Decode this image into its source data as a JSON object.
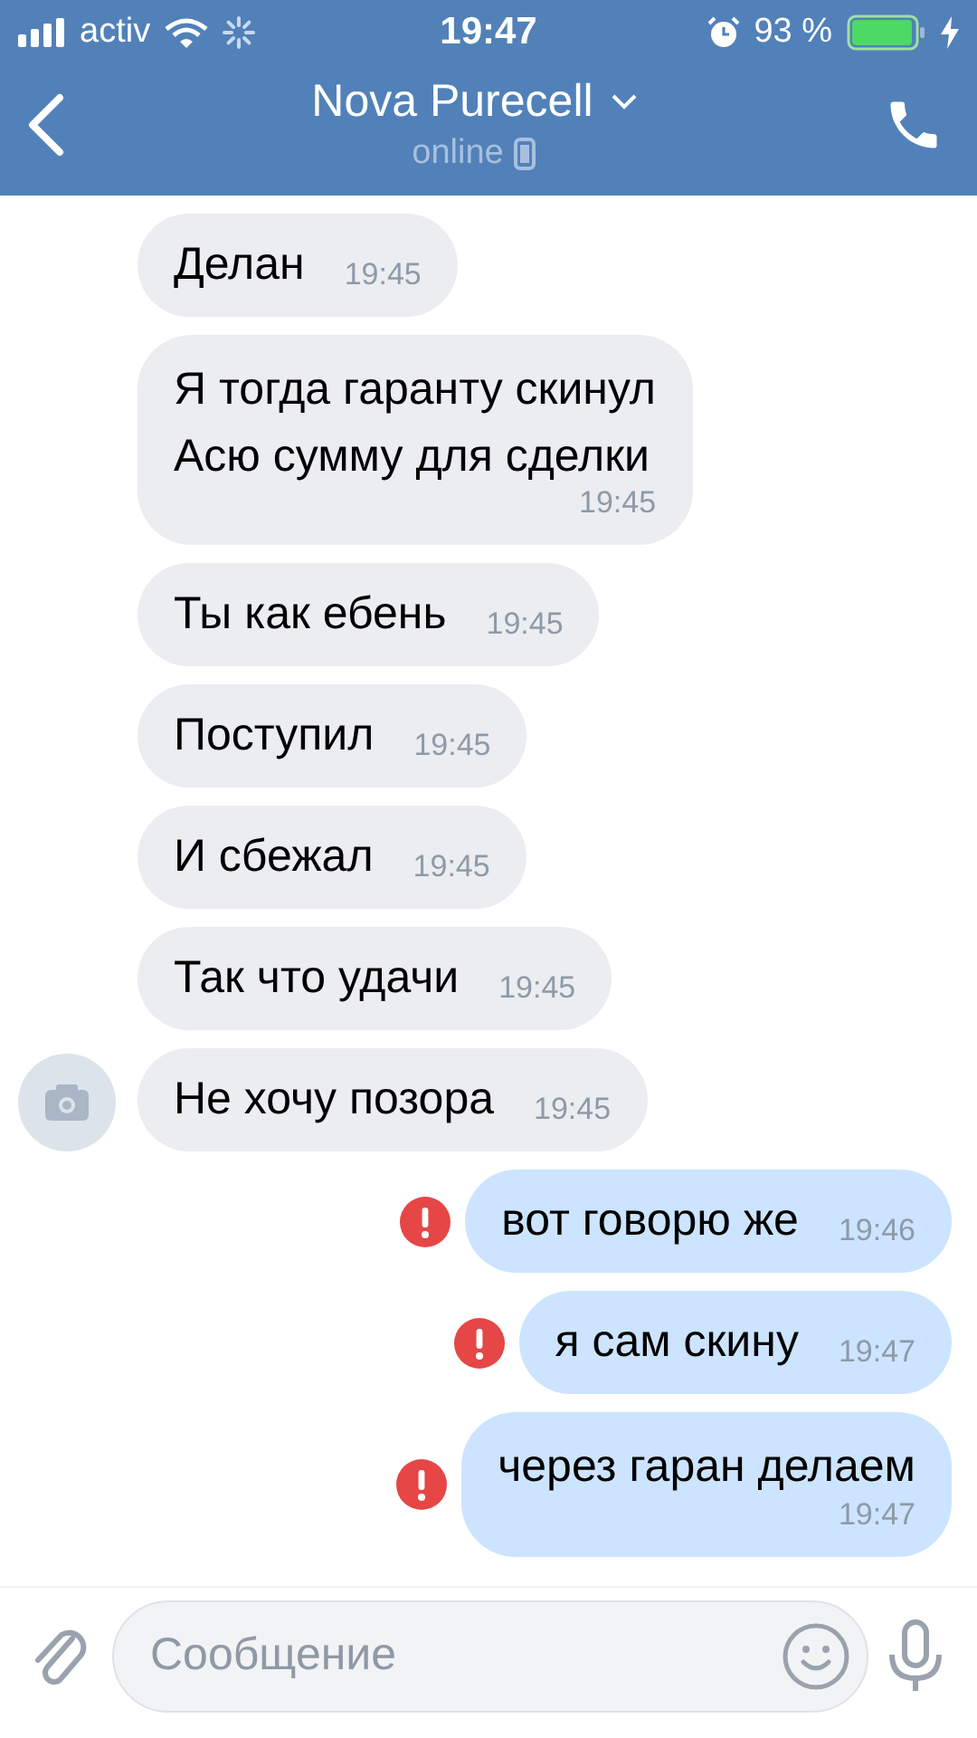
{
  "status_bar": {
    "carrier": "activ",
    "time": "19:47",
    "battery": "93 %"
  },
  "header": {
    "title": "Nova Purecell",
    "status": "online"
  },
  "messages": [
    {
      "outgoing": false,
      "kind": "inline",
      "text": "Делан",
      "time": "19:45",
      "avatar": false,
      "failed": false
    },
    {
      "outgoing": false,
      "kind": "stacked",
      "text": "Я тогда гаранту скинул\nАсю сумму для сделки",
      "time": "19:45",
      "avatar": false,
      "failed": false
    },
    {
      "outgoing": false,
      "kind": "inline",
      "text": "Ты как ебень",
      "time": "19:45",
      "avatar": false,
      "failed": false
    },
    {
      "outgoing": false,
      "kind": "inline",
      "text": "Поступил",
      "time": "19:45",
      "avatar": false,
      "failed": false
    },
    {
      "outgoing": false,
      "kind": "inline",
      "text": "И сбежал",
      "time": "19:45",
      "avatar": false,
      "failed": false
    },
    {
      "outgoing": false,
      "kind": "inline",
      "text": "Так что удачи",
      "time": "19:45",
      "avatar": false,
      "failed": false
    },
    {
      "outgoing": false,
      "kind": "inline",
      "text": "Не хочу позора",
      "time": "19:45",
      "avatar": true,
      "failed": false
    },
    {
      "outgoing": true,
      "kind": "inline",
      "text": "вот говорю же",
      "time": "19:46",
      "avatar": false,
      "failed": true
    },
    {
      "outgoing": true,
      "kind": "inline",
      "text": "я сам скину",
      "time": "19:47",
      "avatar": false,
      "failed": true
    },
    {
      "outgoing": true,
      "kind": "stacked",
      "text": "через гаран делаем",
      "time": "19:47",
      "avatar": false,
      "failed": true
    }
  ],
  "composer": {
    "placeholder": "Сообщение"
  }
}
